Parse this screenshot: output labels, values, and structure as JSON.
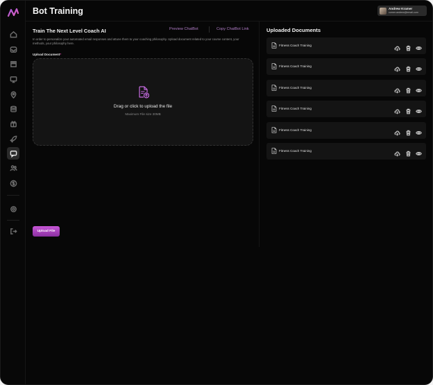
{
  "header": {
    "title": "Bot Training",
    "user": {
      "name": "Andrew Kramer",
      "email": "corner.andrew@email.com"
    }
  },
  "sidebar": {
    "items": [
      {
        "icon": "home-icon"
      },
      {
        "icon": "inbox-icon"
      },
      {
        "icon": "archive-icon"
      },
      {
        "icon": "monitor-icon"
      },
      {
        "icon": "location-icon"
      },
      {
        "icon": "database-icon"
      },
      {
        "icon": "gift-icon"
      },
      {
        "icon": "rocket-icon"
      },
      {
        "icon": "chat-bot-icon",
        "active": true
      },
      {
        "icon": "users-icon"
      },
      {
        "icon": "dollar-icon"
      },
      {
        "icon": "settings-icon"
      },
      {
        "icon": "logout-icon"
      }
    ]
  },
  "training": {
    "title": "Train The Next Level Coach AI",
    "preview_link": "Preview ChatBot",
    "copy_link": "Copy ChatBot Link",
    "description": "In order to personalize your automated email responses and attune them to your coaching philosophy. Upload document related to your course content, your methods, your philosophy here.",
    "upload_label": "Upload Document",
    "required_mark": "*",
    "dropzone_text": "Drag or click to upload the file",
    "dropzone_subtext": "Maximum File size 30MB",
    "upload_button": "Upload File"
  },
  "documents": {
    "title": "Uploaded Documents",
    "items": [
      {
        "name": "Fitness Coach Training"
      },
      {
        "name": "Fitness Coach Training"
      },
      {
        "name": "Fitness Coach Training"
      },
      {
        "name": "Fitness Coach Training"
      },
      {
        "name": "Fitness Coach Training"
      },
      {
        "name": "Fitness Coach Training"
      }
    ]
  },
  "colors": {
    "accent": "#b07cc6",
    "button_gradient_top": "#c656d6",
    "button_gradient_bottom": "#8a2fa0",
    "background": "#070707",
    "card": "#141414"
  }
}
